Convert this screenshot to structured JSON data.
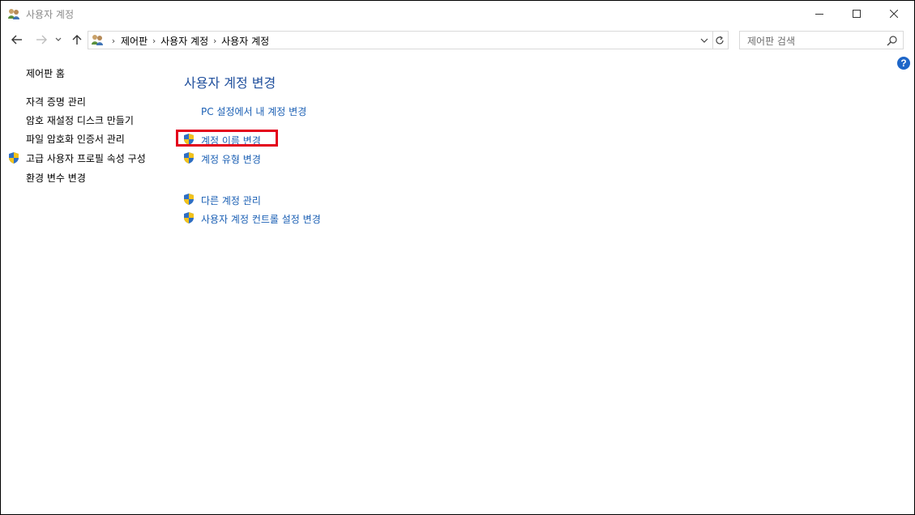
{
  "window": {
    "title": "사용자 계정",
    "icon": "user-accounts-icon"
  },
  "caption_buttons": [
    "minimize-icon",
    "maximize-icon",
    "close-icon"
  ],
  "navigation": {
    "buttons": [
      "back-arrow-icon",
      "forward-arrow-icon",
      "recent-dropdown-icon",
      "up-arrow-icon"
    ],
    "breadcrumb": [
      "제어판",
      "사용자 계정",
      "사용자 계정"
    ],
    "refresh_icon": "refresh-icon"
  },
  "search": {
    "placeholder": "제어판 검색"
  },
  "sidebar": {
    "home": "제어판 홈",
    "items": [
      {
        "label": "자격 증명 관리",
        "shield": false
      },
      {
        "label": "암호 재설정 디스크 만들기",
        "shield": false
      },
      {
        "label": "파일 암호화 인증서 관리",
        "shield": false
      },
      {
        "label": "고급 사용자 프로필 속성 구성",
        "shield": true
      },
      {
        "label": "환경 변수 변경",
        "shield": false
      }
    ]
  },
  "main": {
    "heading": "사용자 계정 변경",
    "links": [
      {
        "label": "PC 설정에서 내 계정 변경",
        "shield": false
      },
      {
        "label": "계정 이름 변경",
        "shield": true,
        "highlighted": true
      },
      {
        "label": "계정 유형 변경",
        "shield": true
      },
      {
        "label": "다른 계정 관리",
        "shield": true
      },
      {
        "label": "사용자 계정 컨트롤 설정 변경",
        "shield": true
      }
    ]
  },
  "colors": {
    "link": "#1a5fb4",
    "heading": "#1e4e9c",
    "highlight": "#e3001b",
    "help": "#1e66c8"
  }
}
